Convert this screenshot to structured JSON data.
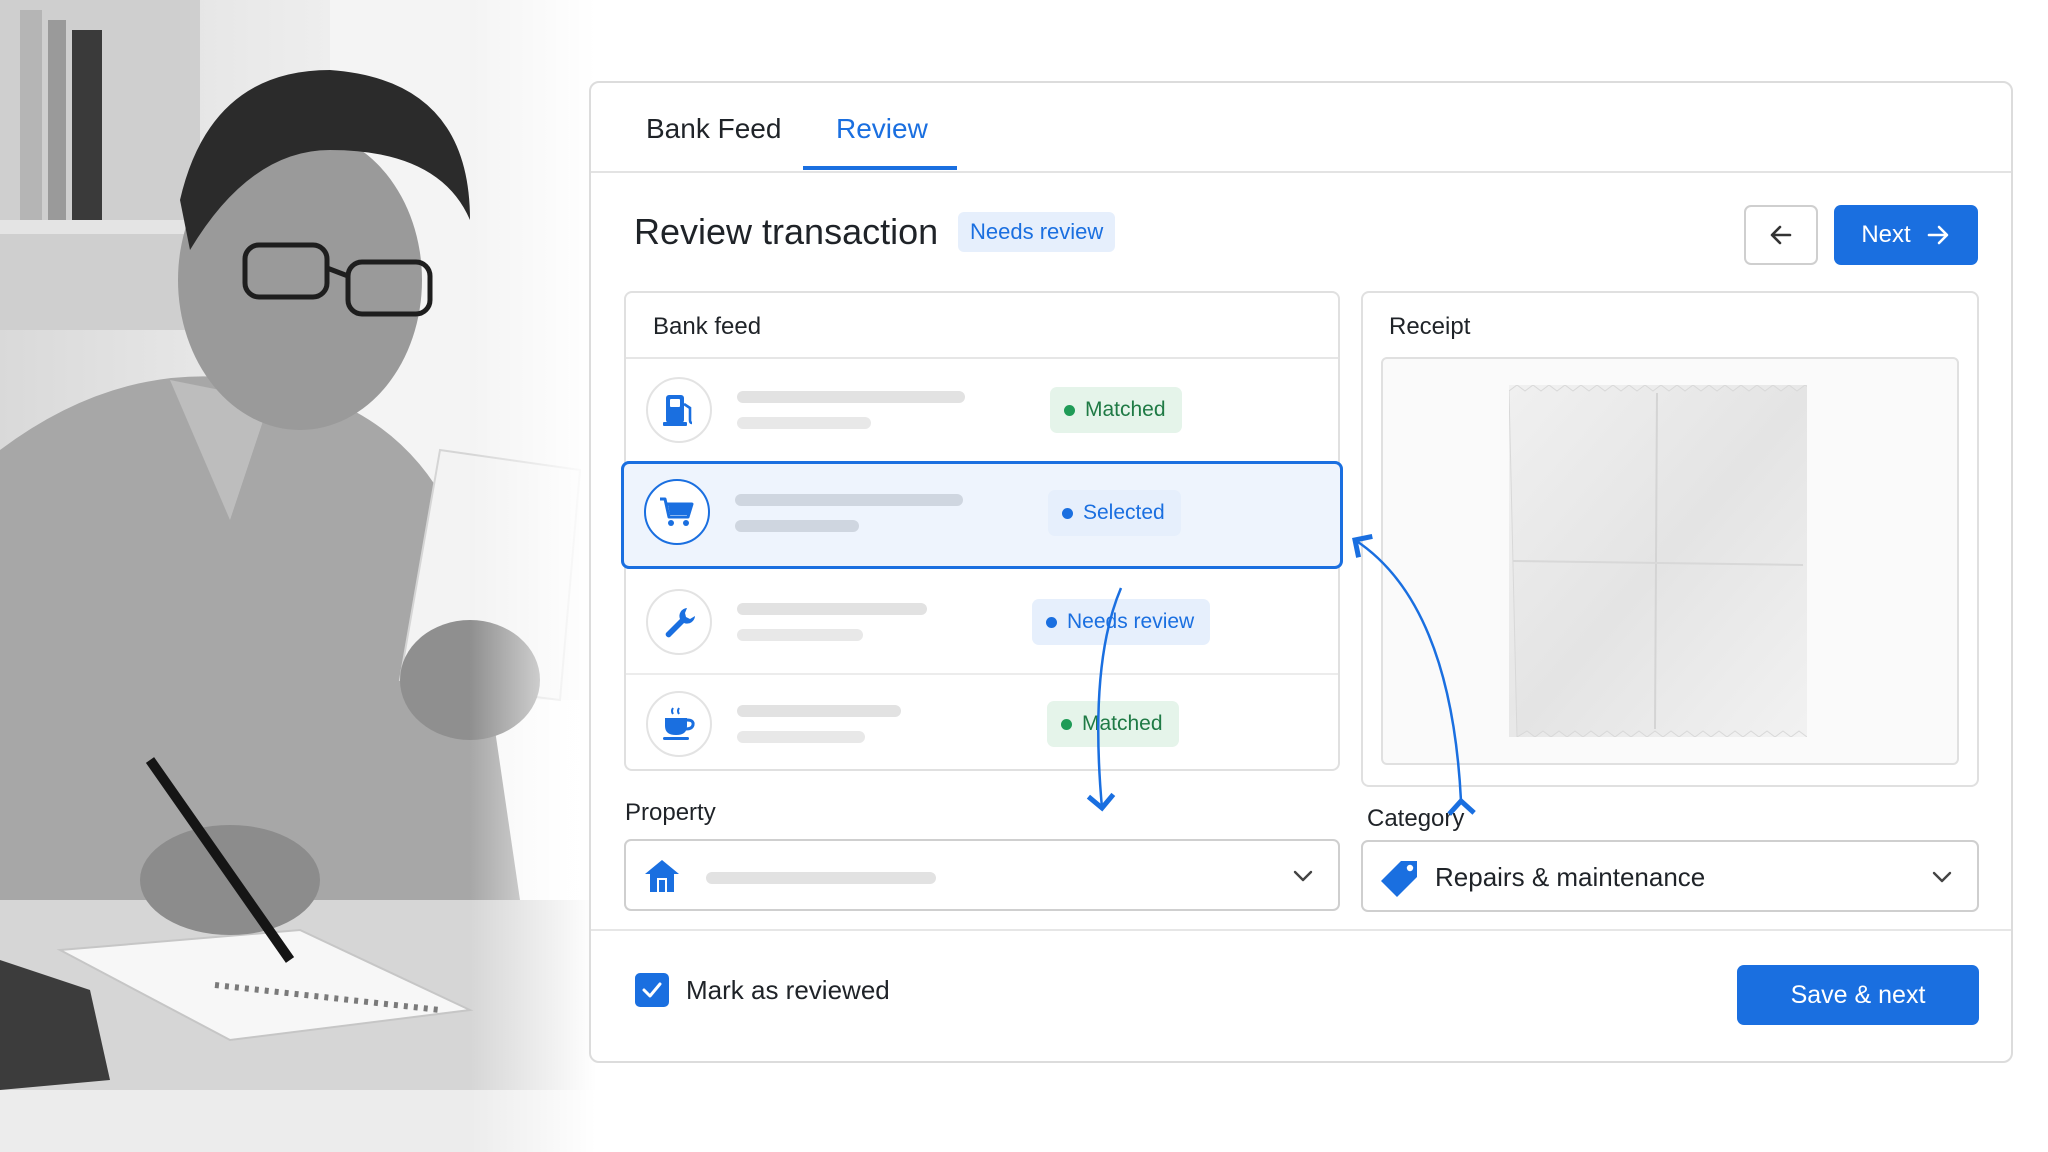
{
  "tabs": [
    {
      "label": "Bank Feed",
      "active": false
    },
    {
      "label": "Review",
      "active": true
    }
  ],
  "header": {
    "title": "Review transaction",
    "badge": "Needs review",
    "next_label": "Next"
  },
  "bank_feed": {
    "heading": "Bank feed",
    "rows": [
      {
        "icon": "fuel-pump-icon",
        "status": "Matched",
        "selected": false
      },
      {
        "icon": "shopping-cart-icon",
        "status": "Selected",
        "selected": true
      },
      {
        "icon": "wrench-icon",
        "status": "Needs review",
        "selected": false
      },
      {
        "icon": "coffee-cup-icon",
        "status": "Matched",
        "selected": false
      }
    ]
  },
  "receipt": {
    "heading": "Receipt"
  },
  "property": {
    "label": "Property",
    "icon": "home-icon"
  },
  "category": {
    "label": "Category",
    "value": "Repairs & maintenance",
    "icon": "tag-icon"
  },
  "footer": {
    "checkbox_label": "Mark as reviewed",
    "checked": true,
    "save_label": "Save & next"
  },
  "colors": {
    "accent": "#1a6fe0",
    "matched": "#1f9b57",
    "badge_bg": "#e6effc"
  }
}
